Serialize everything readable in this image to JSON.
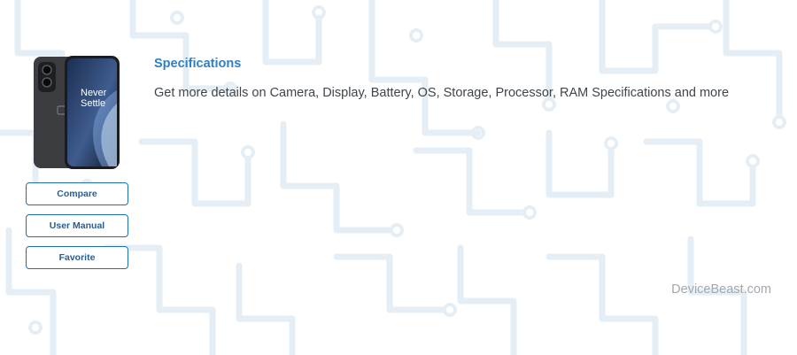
{
  "product": {
    "image_alt": "OnePlus smartphone",
    "screen_text_line1": "Never",
    "screen_text_line2": "Settle"
  },
  "actions": {
    "compare_label": "Compare",
    "user_manual_label": "User Manual",
    "favorite_label": "Favorite"
  },
  "specs": {
    "title": "Specifications",
    "description": "Get more details on Camera, Display, Battery, OS, Storage, Processor, RAM Specifications and more"
  },
  "footer": {
    "brand": "DeviceBeast.com"
  },
  "colors": {
    "accent": "#2f7fc1",
    "button_border": "#1f6fb8",
    "pattern": "#e3edf3"
  }
}
